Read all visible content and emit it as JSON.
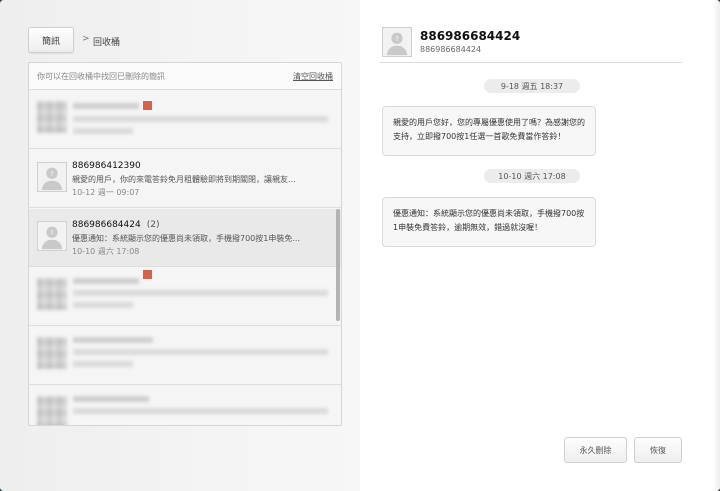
{
  "toolbar": {
    "back_label": "簡訊",
    "separator": ">",
    "title": "回收桶"
  },
  "list": {
    "hint": "你可以在回收桶中找回已刪除的簡訊",
    "clear_label": "清空回收桶",
    "threads": [
      {
        "name": "886986412390",
        "count": "",
        "snippet": "親愛的用戶，你的來電答鈴免月租體驗即將到期關閉，讓親友...",
        "time": "10-12 週一 09:07"
      },
      {
        "name": "886986684424",
        "count": "(2)",
        "snippet": "優惠通知：系統顯示您的優惠尚未領取，手機撥700按1申裝免...",
        "time": "10-10 週六 17:08"
      }
    ]
  },
  "conversation": {
    "name": "886986684424",
    "number": "886986684424",
    "messages": [
      {
        "date": "9-18 週五 18:37",
        "text": "親愛的用戶您好，您的專屬優惠使用了嗎？為感謝您的支持，立即撥700按1任選一首歌免費當作答鈴！"
      },
      {
        "date": "10-10 週六 17:08",
        "text": "優惠通知：系統顯示您的優惠尚未領取，手機撥700按1申裝免費答鈴，逾期無效，錯過就沒喔！"
      }
    ]
  },
  "actions": {
    "delete_label": "永久刪除",
    "restore_label": "恢復"
  },
  "colors": {
    "accent_badge": "#d9614a",
    "selected_row": "#e9e9e9"
  }
}
